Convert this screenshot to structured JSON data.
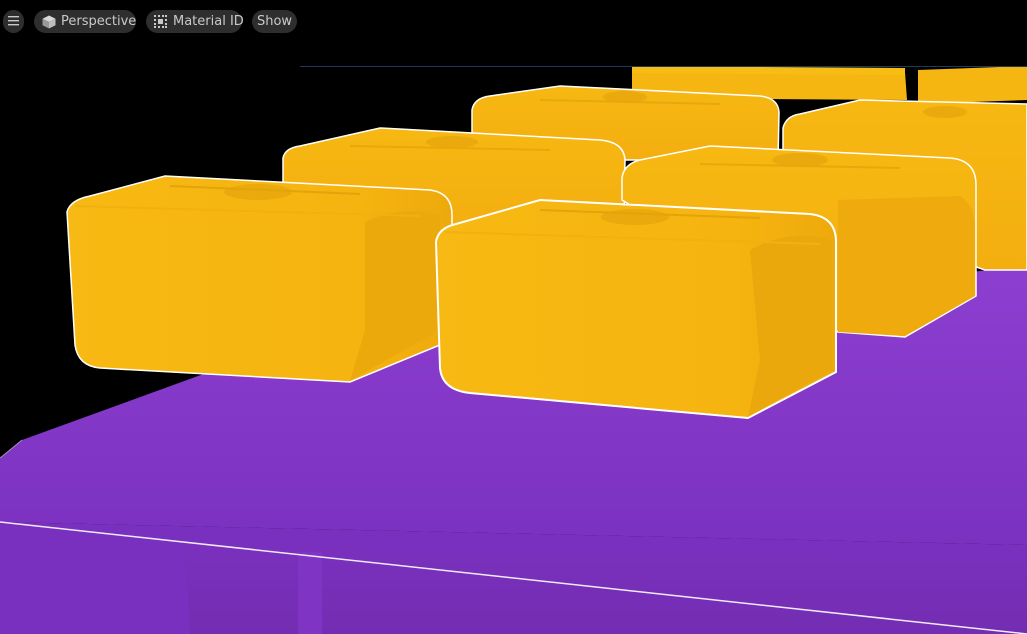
{
  "toolbar": {
    "menu_icon": "hamburger-menu-icon",
    "view_mode": {
      "icon": "perspective-cube-icon",
      "label": "Perspective"
    },
    "view_mode_display": {
      "icon": "material-id-icon",
      "label": "Material ID"
    },
    "show_label": "Show"
  },
  "scene": {
    "platform_color": "#7b32c1",
    "block_color": "#f6b712",
    "selection_outline_color": "#ffffff",
    "background_color": "#000000"
  }
}
